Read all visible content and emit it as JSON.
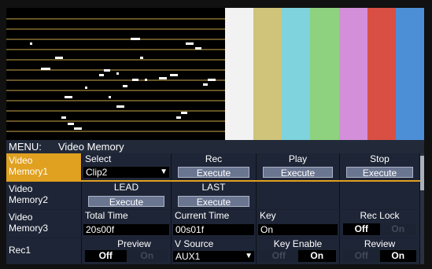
{
  "colors": {
    "accent": "#e0a020",
    "bars": [
      "#f2f2f2",
      "#cfc47a",
      "#7ed3dc",
      "#8ed27f",
      "#d38fd9",
      "#d94f43",
      "#4c8fd6"
    ]
  },
  "menu": {
    "label": "MENU:",
    "title": "Video Memory"
  },
  "rows": [
    {
      "label_line1": "Video",
      "label_line2": "Memory1",
      "cells": {
        "select": {
          "header": "Select",
          "value": "Clip2"
        },
        "rec": {
          "header": "Rec",
          "button": "Execute"
        },
        "play": {
          "header": "Play",
          "button": "Execute"
        },
        "stop": {
          "header": "Stop",
          "button": "Execute"
        }
      }
    },
    {
      "label_line1": "Video",
      "label_line2": "Memory2",
      "cells": {
        "lead": {
          "header": "LEAD",
          "button": "Execute"
        },
        "last": {
          "header": "LAST",
          "button": "Execute"
        }
      }
    },
    {
      "label_line1": "Video",
      "label_line2": "Memory3",
      "cells": {
        "total": {
          "header": "Total Time",
          "value": "20s00f"
        },
        "current": {
          "header": "Current Time",
          "value": "00s01f"
        },
        "key": {
          "header": "Key",
          "value": "On"
        },
        "reclock": {
          "header": "Rec Lock",
          "off": "Off",
          "on": "On"
        }
      }
    },
    {
      "label_line1": "Rec1",
      "cells": {
        "preview": {
          "header": "Preview",
          "off": "Off",
          "on": "On"
        },
        "vsource": {
          "header": "V Source",
          "value": "AUX1"
        },
        "keyenable": {
          "header": "Key Enable",
          "off": "Off",
          "on": "On"
        },
        "review": {
          "header": "Review",
          "off": "Off",
          "on": "On"
        }
      }
    }
  ]
}
